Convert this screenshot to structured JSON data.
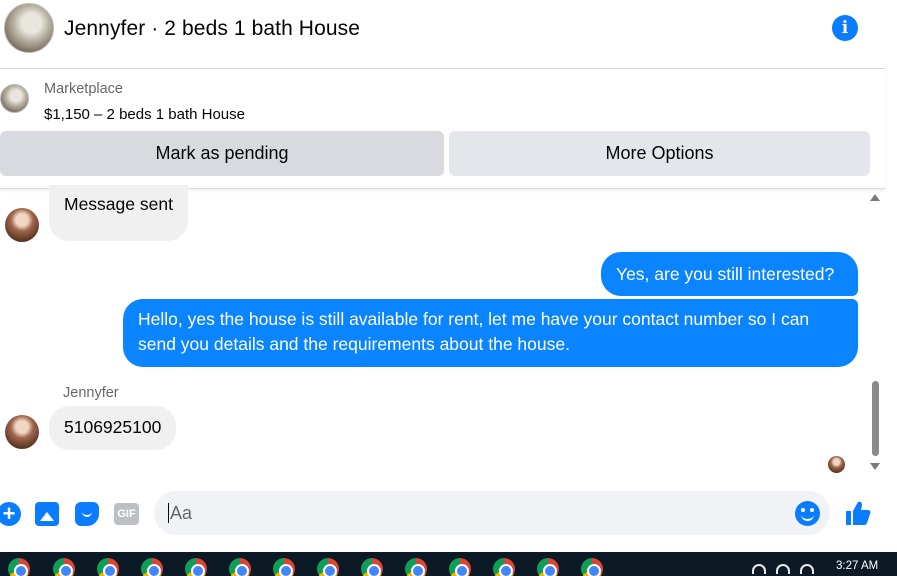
{
  "header": {
    "title": "Jennyfer · 2 beds 1 bath House",
    "info_icon": "i"
  },
  "listing": {
    "source": "Marketplace",
    "price_line": "$1,150 – 2 beds 1 bath House",
    "buttons": {
      "pending": "Mark as pending",
      "more": "More Options"
    }
  },
  "messages": [
    {
      "direction": "incoming",
      "text": "Message sent"
    },
    {
      "direction": "outgoing",
      "text": "Yes, are you still interested?"
    },
    {
      "direction": "outgoing",
      "text": "Hello, yes the house is still available for rent, let me have your contact number so I can send you details and the requirements about the house."
    },
    {
      "direction": "incoming",
      "sender": "Jennyfer",
      "text": "5106925100"
    }
  ],
  "composer": {
    "placeholder": "Aa",
    "gif_label": "GIF",
    "plus_label": "+"
  },
  "taskbar": {
    "time": "3:27 AM"
  },
  "colors": {
    "accent": "#0a84ff",
    "incoming_bubble": "#f0f0f0",
    "button_gray": "#e4e6eb"
  }
}
